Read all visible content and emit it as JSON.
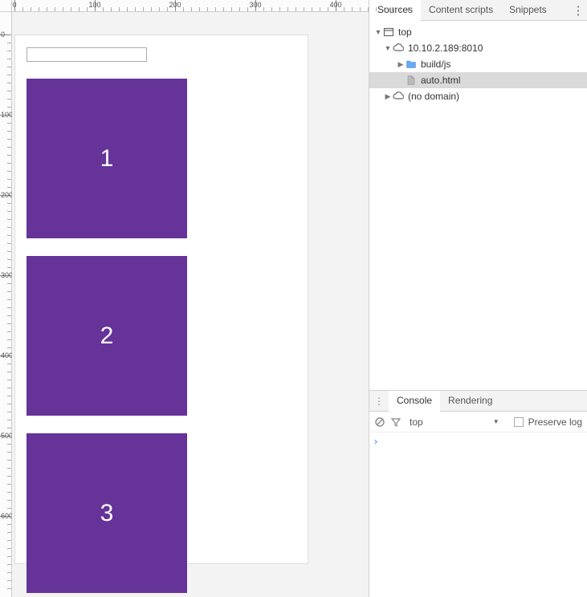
{
  "ruler_h": [
    "0",
    "100",
    "200",
    "300",
    "400"
  ],
  "ruler_v": [
    "0",
    "100",
    "200",
    "300",
    "400",
    "500",
    "600"
  ],
  "box_labels": [
    "1",
    "2",
    "3"
  ],
  "box_color": "#663399",
  "tabs": {
    "sources": "Sources",
    "content_scripts": "Content scripts",
    "snippets": "Snippets"
  },
  "tree": {
    "top": "top",
    "domain": "10.10.2.189:8010",
    "folder": "build/js",
    "file": "auto.html",
    "nodomain": "(no domain)"
  },
  "console_tabs": {
    "console": "Console",
    "rendering": "Rendering"
  },
  "console_toolbar": {
    "context": "top",
    "preserve": "Preserve log"
  },
  "console_prompt": "›"
}
